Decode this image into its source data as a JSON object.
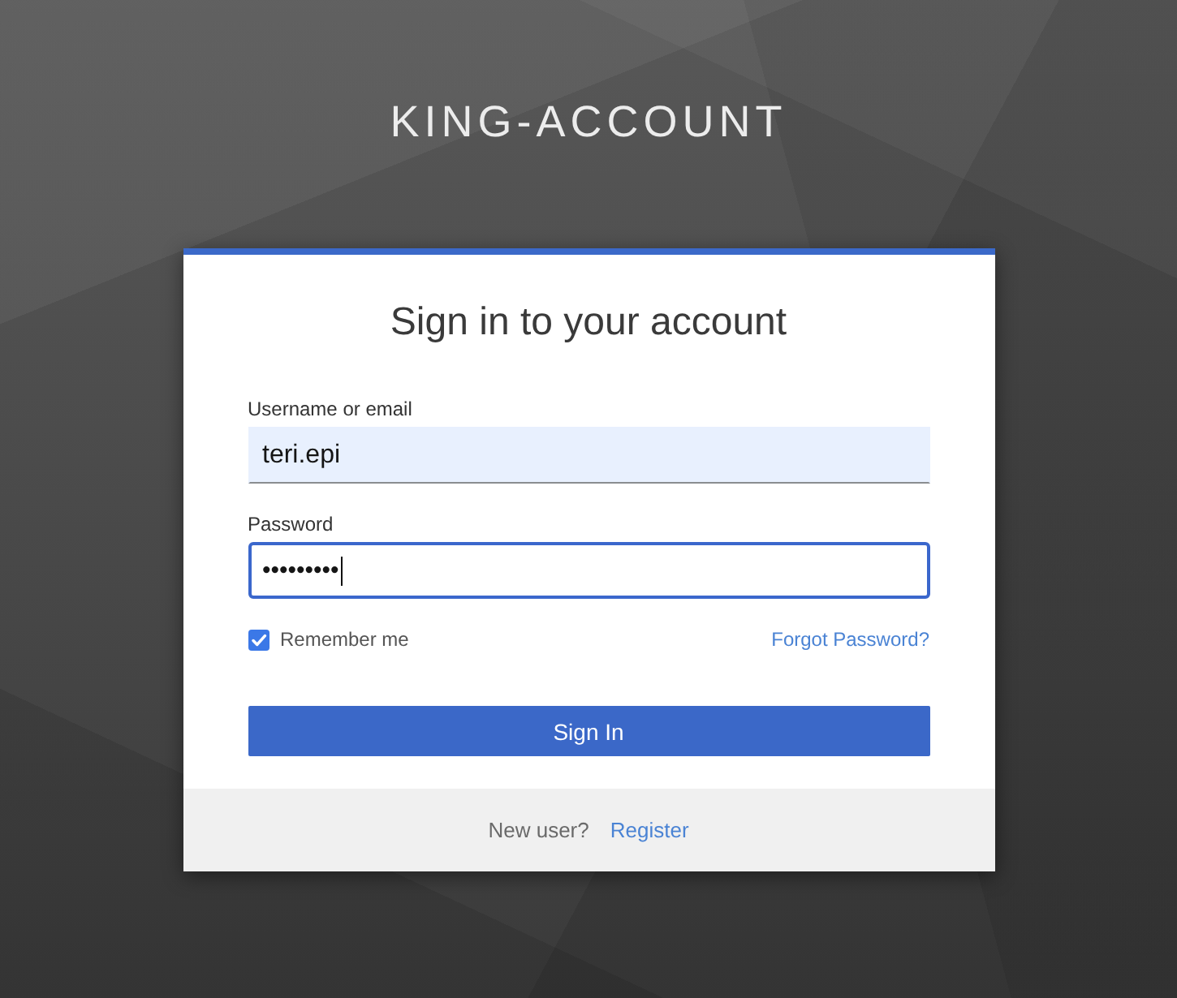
{
  "brand": {
    "title": "KING-ACCOUNT"
  },
  "card": {
    "heading": "Sign in to your account",
    "fields": [
      {
        "label": "Username or email",
        "value": "teri.epi",
        "autofilled": true,
        "focused": false
      },
      {
        "label": "Password",
        "value": "•••••••••",
        "autofilled": false,
        "focused": true
      }
    ],
    "remember": {
      "label": "Remember me",
      "checked": true
    },
    "forgot_link": "Forgot Password?",
    "submit_button": "Sign In"
  },
  "footer": {
    "prompt": "New user?",
    "register_link": "Register"
  }
}
